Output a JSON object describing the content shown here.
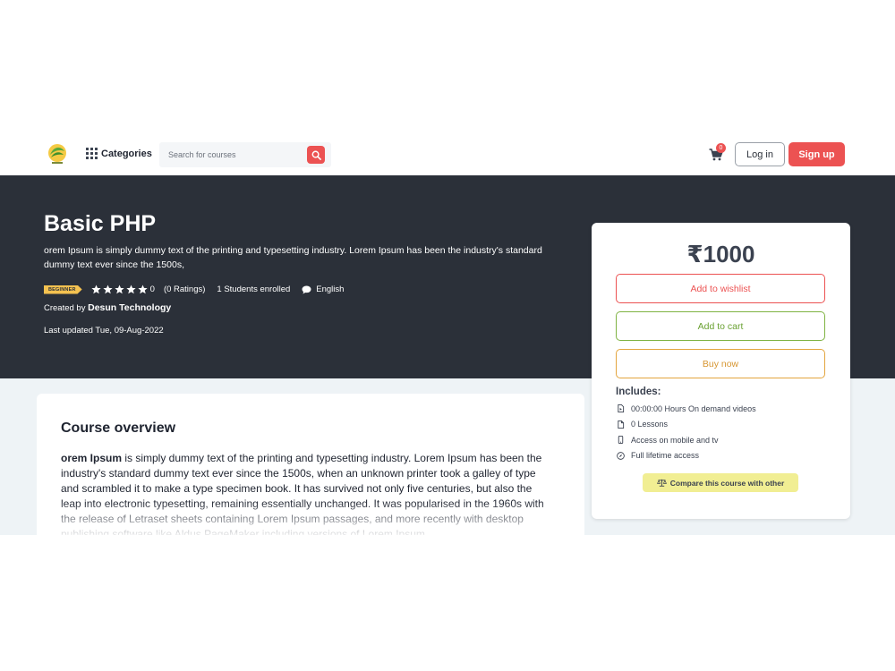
{
  "header": {
    "logo_icon": "brand-logo-icon",
    "categories_label": "Categories",
    "categories_icon": "grid-icon",
    "search": {
      "placeholder": "Search for courses",
      "icon": "search-icon"
    },
    "cart": {
      "icon": "cart-icon",
      "count": "0"
    },
    "login_label": "Log in",
    "signup_label": "Sign up"
  },
  "course": {
    "title": "Basic PHP",
    "description": "orem Ipsum is simply dummy text of the printing and typesetting industry. Lorem Ipsum has been the industry's standard dummy text ever since the 1500s,",
    "level": "BEGINNER",
    "rating": {
      "stars": 5,
      "value": "0",
      "count_label": "(0 Ratings)"
    },
    "students": "1 Students enrolled",
    "language": "English",
    "created_by_prefix": "Created by",
    "author": "Desun Technology",
    "last_updated": "Last updated Tue, 09-Aug-2022"
  },
  "overview": {
    "title": "Course overview",
    "lead": "orem Ipsum",
    "text": " is simply dummy text of the printing and typesetting industry. Lorem Ipsum has been the industry's standard dummy text ever since the 1500s, when an unknown printer took a galley of type and scrambled it to make a type specimen book. It has survived not only five centuries, but also the leap into electronic typesetting, remaining essentially unchanged. It was popularised in the 1960s with the release of Letraset sheets containing Lorem Ipsum passages, and more recently with desktop publishing software like Aldus PageMaker including versions of Lorem Ipsum."
  },
  "purchase": {
    "price": "₹1000",
    "wishlist_label": "Add to wishlist",
    "cart_label": "Add to cart",
    "buy_label": "Buy now",
    "includes_title": "Includes:",
    "includes": [
      {
        "icon": "file-video-icon",
        "label": "00:00:00 Hours On demand videos"
      },
      {
        "icon": "file-icon",
        "label": "0 Lessons"
      },
      {
        "icon": "mobile-icon",
        "label": "Access on mobile and tv"
      },
      {
        "icon": "compass-icon",
        "label": "Full lifetime access"
      }
    ],
    "compare_label": "Compare this course with other",
    "compare_icon": "balance-scale-icon"
  },
  "colors": {
    "accent": "#ec5252",
    "hero_bg": "#2b3039",
    "green": "#7fb342",
    "orange": "#e3a53e",
    "badge": "#f5c250",
    "compare_bg": "#f1ee93"
  }
}
